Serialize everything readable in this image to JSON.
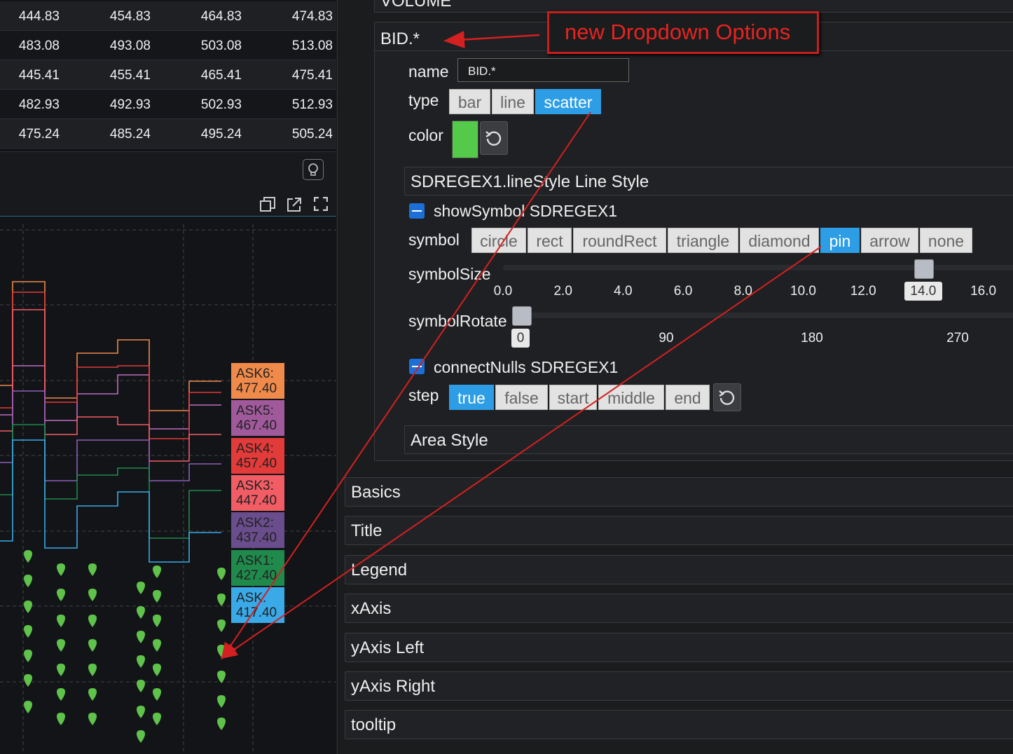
{
  "table": {
    "rows": [
      [
        "444.83",
        "454.83",
        "464.83",
        "474.83"
      ],
      [
        "483.08",
        "493.08",
        "503.08",
        "513.08"
      ],
      [
        "445.41",
        "455.41",
        "465.41",
        "475.41"
      ],
      [
        "482.93",
        "492.93",
        "502.93",
        "512.93"
      ],
      [
        "475.24",
        "485.24",
        "495.24",
        "505.24"
      ]
    ]
  },
  "toolbar_icons": [
    "lightbulb-icon",
    "restore-window-icon",
    "external-link-icon",
    "fullscreen-icon"
  ],
  "chart": {
    "ask_labels": [
      {
        "label": "ASK6:",
        "value": "477.40",
        "color": "#f08a4b"
      },
      {
        "label": "ASK5:",
        "value": "467.40",
        "color": "#a05a9c"
      },
      {
        "label": "ASK4:",
        "value": "457.40",
        "color": "#e33a3a"
      },
      {
        "label": "ASK3:",
        "value": "447.40",
        "color": "#f25c64"
      },
      {
        "label": "ASK2:",
        "value": "437.40",
        "color": "#6a4d8c"
      },
      {
        "label": "ASK1:",
        "value": "427.40",
        "color": "#1f8a4c"
      },
      {
        "label": "ASK:",
        "value": "417.40",
        "color": "#39a9e8"
      }
    ],
    "symbol_color": "#5fc24a"
  },
  "panel": {
    "volume_header": "VOLUME",
    "series_header": "BID.*",
    "annotation": "new Dropdown Options",
    "name_label": "name",
    "name_value": "BID.*",
    "type_label": "type",
    "type_options": [
      "bar",
      "line",
      "scatter"
    ],
    "type_selected": "scatter",
    "color_label": "color",
    "color_value": "#55c94a",
    "linestyle_header": "SDREGEX1.lineStyle Line Style",
    "show_symbol": "showSymbol SDREGEX1",
    "symbol_label": "symbol",
    "symbol_options": [
      "circle",
      "rect",
      "roundRect",
      "triangle",
      "diamond",
      "pin",
      "arrow",
      "none"
    ],
    "symbol_selected": "pin",
    "symbol_size_label": "symbolSize",
    "symbol_size_ticks": [
      "0.0",
      "2.0",
      "4.0",
      "6.0",
      "8.0",
      "10.0",
      "12.0",
      "14.0",
      "16.0"
    ],
    "symbol_size_value": "14.0",
    "symbol_rotate_label": "symbolRotate",
    "symbol_rotate_ticks": [
      "90",
      "180",
      "270"
    ],
    "symbol_rotate_value": "0",
    "connect_nulls": "connectNulls SDREGEX1",
    "step_label": "step",
    "step_options": [
      "true",
      "false",
      "start",
      "middle",
      "end"
    ],
    "step_selected": "true",
    "area_style": "Area Style",
    "sections": [
      "Basics",
      "Title",
      "Legend",
      "xAxis",
      "yAxis Left",
      "yAxis Right",
      "tooltip"
    ]
  }
}
